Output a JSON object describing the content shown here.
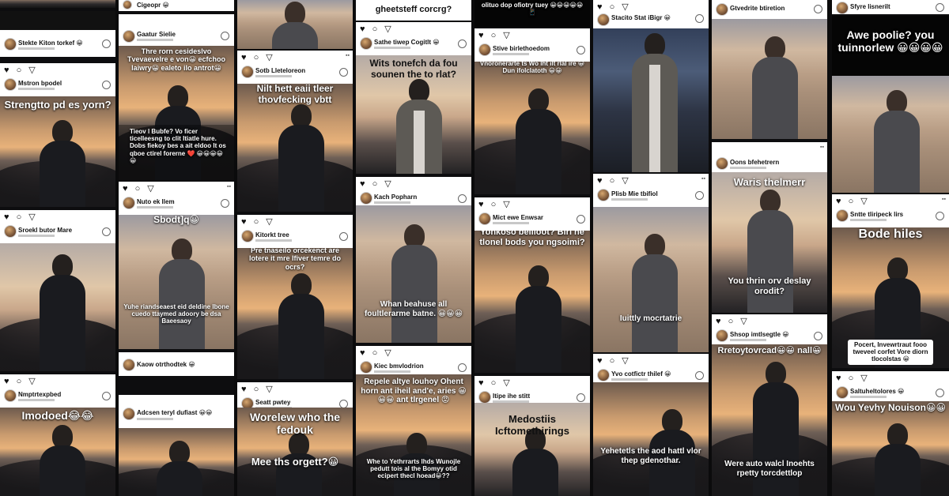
{
  "colors": {
    "header_bg": "#ffffff",
    "caption_text": "#ffffff",
    "emoji": "#f2c22e"
  },
  "icons": {
    "actions": "♥ ○ ▽",
    "more": "more-icon",
    "like": "heart-icon",
    "comment": "comment-icon",
    "share": "share-icon"
  },
  "columns": [
    {
      "posts": [
        {
          "username": "Stekte Kiton torkef 😀",
          "caption": ""
        },
        {
          "username": "Mstron bpodel",
          "caption": "Strengtto pd es yorn?"
        },
        {
          "username": "Sroekl butor Mare",
          "caption": ""
        },
        {
          "username": "Nmptrtexpbed",
          "caption": "Imodoed😂😂"
        }
      ]
    },
    {
      "posts": [
        {
          "username": "Cigeopr 😀",
          "caption": ""
        },
        {
          "username": "Gaatur Sielie",
          "caption": "Thre rorn cesideslvo Tvevaevelre e von😀 ecfchoo laiwry😀 ealeto ilo antrot😀"
        },
        {
          "username": "",
          "caption": "Tieov l Bubfe? Vo ficer ticelleesng to clit Itiatle hure. Dobs fiekoy bes a ait eldoo lt os qboe ctirel forerne ❤️ 😀😀😀😀😀"
        },
        {
          "username": "Nuto ek llem",
          "caption": "Sbodt]q😀"
        },
        {
          "username": "",
          "caption": "Yuhe riandseaest eid deldine Ibone cuedo ttaymed adoory be dsa Baeesaoy"
        },
        {
          "username": "Kaow otrthodtek 😀",
          "caption": ""
        },
        {
          "username": "Adcsen teryl dufiast 😀😀",
          "caption": ""
        }
      ]
    },
    {
      "posts": [
        {
          "username": "",
          "caption": ""
        },
        {
          "username": "Sotb Lleteloreon",
          "caption": "Nilt hett eaii tleer thovfecking vbtt"
        },
        {
          "username": "Kitorkt tree",
          "caption": "Pre tnaseilo orcekenct are lotere it mre lfiver temre do ocrs?"
        },
        {
          "username": "Seatt pwtey",
          "caption": "Worelew who the fedouk"
        },
        {
          "username": "",
          "caption": "Mee ths orgett?😀"
        }
      ]
    },
    {
      "posts": [
        {
          "username": "",
          "caption": "gheetsteff corcrg?"
        },
        {
          "username": "Sathe tiwep Cogitlt 😀",
          "caption": "Wits tonefch da fou sounen the to rlat?"
        },
        {
          "username": "Kach Popharn",
          "caption": ""
        },
        {
          "username": "",
          "caption": "Whan beahuse all foultlerarme batne. 😀😀😀"
        },
        {
          "username": "Kiec bmvlodrion",
          "caption": "Repele altye louhoy Ohent horn ant iheil and'e, aries 😀😀😀 ant tlrgenel 😡"
        },
        {
          "username": "",
          "caption": "Whe to Yethrrarts lhds Wunojle pedutt tois al the Bomyy otid ecipert thecl hoead😀??"
        }
      ]
    },
    {
      "posts": [
        {
          "username": "",
          "caption": "olituo dop ofiotry tuey 😀😀😀😀😀 📱"
        },
        {
          "username": "Stive birlethoedom",
          "caption": "Vnoronerarte ts Wo lht ilt rlal ire 😀 Dun ifolclatoth 😀😀"
        },
        {
          "username": "Mict ewe Enwsar",
          "caption": "Yonkoso beilloot? Birl he tlonel bods you ngsoimi?"
        },
        {
          "username": "Itipe ihe stitt",
          "caption": "Medostiis Icftomethirings"
        }
      ]
    },
    {
      "posts": [
        {
          "username": "",
          "caption": ""
        },
        {
          "username": "Stacito Stat iBigr 😀",
          "caption": ""
        },
        {
          "username": "Plisb Mie tbifiol",
          "caption": "Iuittly mocrtatrie"
        },
        {
          "username": "Yvo cotfictr thilef 😀",
          "caption": "Yehetetls the aod hattl vlor thep gdenothar."
        }
      ]
    },
    {
      "posts": [
        {
          "username": "Gtvedrite btiretion",
          "caption": ""
        },
        {
          "username": "Oons bfehetrern",
          "caption": "Waris thelmerr"
        },
        {
          "username": "",
          "caption": "You thrin orv deslay orodit?"
        },
        {
          "username": "Shsop imtlsegtle 😀",
          "caption": "Rretoytovrcad😀😀 nall😀"
        },
        {
          "username": "",
          "caption": "Were auto walcl Inoehts rpetty torcdettlop"
        }
      ]
    },
    {
      "posts": [
        {
          "username": "Sfyre lisnerilt",
          "caption": ""
        },
        {
          "username": "",
          "caption": "Awe poolie? you tuinnorlew 😀😀😀😀"
        },
        {
          "username": "Sntte tliripeck lirs",
          "caption": "Bode hiles"
        },
        {
          "username": "",
          "caption": "Pocert, Invewrtraut fooo tweveel corfet Vore diorn tlocolstas 😀"
        },
        {
          "username": "Saltuheltolores 😀",
          "caption": "Wou Yevhy Nouison😀😀"
        }
      ]
    }
  ]
}
